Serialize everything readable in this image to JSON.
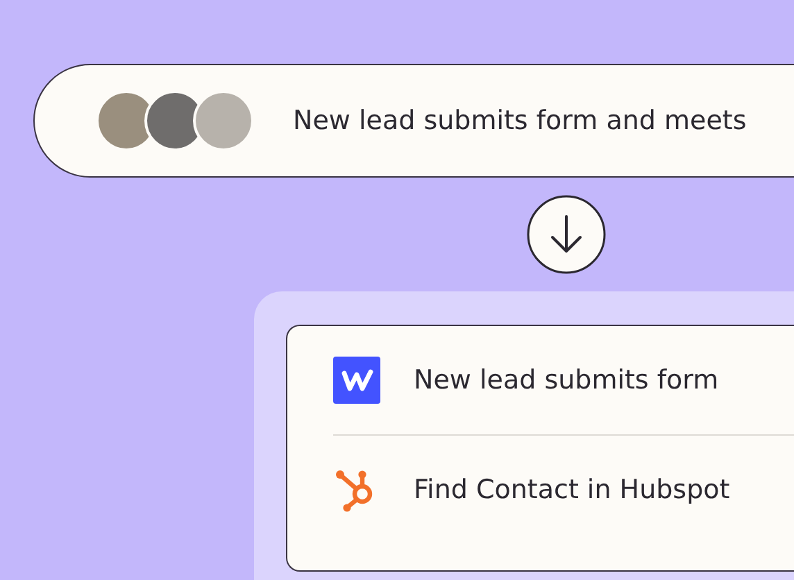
{
  "trigger_pill": {
    "avatars": [
      {
        "kind": "photo"
      },
      {
        "kind": "photo"
      },
      {
        "kind": "photo"
      }
    ],
    "label": "New lead submits form and meets"
  },
  "steps": [
    {
      "kind": "webflow",
      "label": "New lead submits form"
    },
    {
      "kind": "hubspot",
      "label": "Find Contact in Hubspot"
    }
  ]
}
